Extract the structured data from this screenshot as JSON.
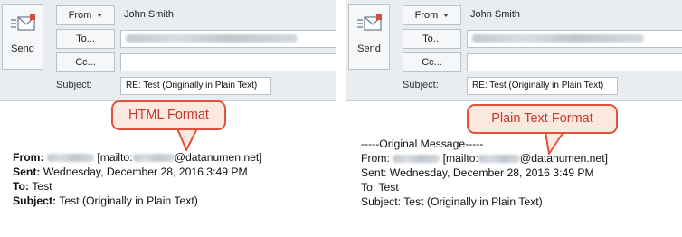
{
  "panels": {
    "left": {
      "send_label": "Send",
      "from_label": "From",
      "from_name": "John Smith",
      "to_label": "To...",
      "cc_label": "Cc...",
      "subject_label": "Subject:",
      "subject_value": "RE: Test (Originally in Plain Text)",
      "callout": "HTML Format",
      "message": {
        "from_label": "From:",
        "mailto_open": "[mailto:",
        "mailto_domain": "@datanumen.net]",
        "sent_label": "Sent:",
        "sent_value": "Wednesday, December 28, 2016 3:49 PM",
        "to_label": "To:",
        "to_value": "Test",
        "subject_label": "Subject:",
        "subject_value": "Test (Originally in Plain Text)"
      }
    },
    "right": {
      "send_label": "Send",
      "from_label": "From",
      "from_name": "John Smith",
      "to_label": "To...",
      "cc_label": "Cc...",
      "subject_label": "Subject:",
      "subject_value": "RE: Test (Originally in Plain Text)",
      "callout": "Plain Text Format",
      "message": {
        "separator": "-----Original Message-----",
        "from_label": "From:",
        "mailto_open": "[mailto:",
        "mailto_domain": "@datanumen.net]",
        "sent_label": "Sent:",
        "sent_value": "Wednesday, December 28, 2016 3:49 PM",
        "to_label": "To:",
        "to_value": "Test",
        "subject_label": "Subject:",
        "subject_value": "Test (Originally in Plain Text)"
      }
    }
  },
  "colors": {
    "header_bg": "#e9edf2",
    "callout_border": "#e0523d",
    "callout_fill": "#fbe9df",
    "callout_text": "#c8372b"
  },
  "icons": [
    "send-envelope-icon",
    "dropdown-caret-icon"
  ]
}
